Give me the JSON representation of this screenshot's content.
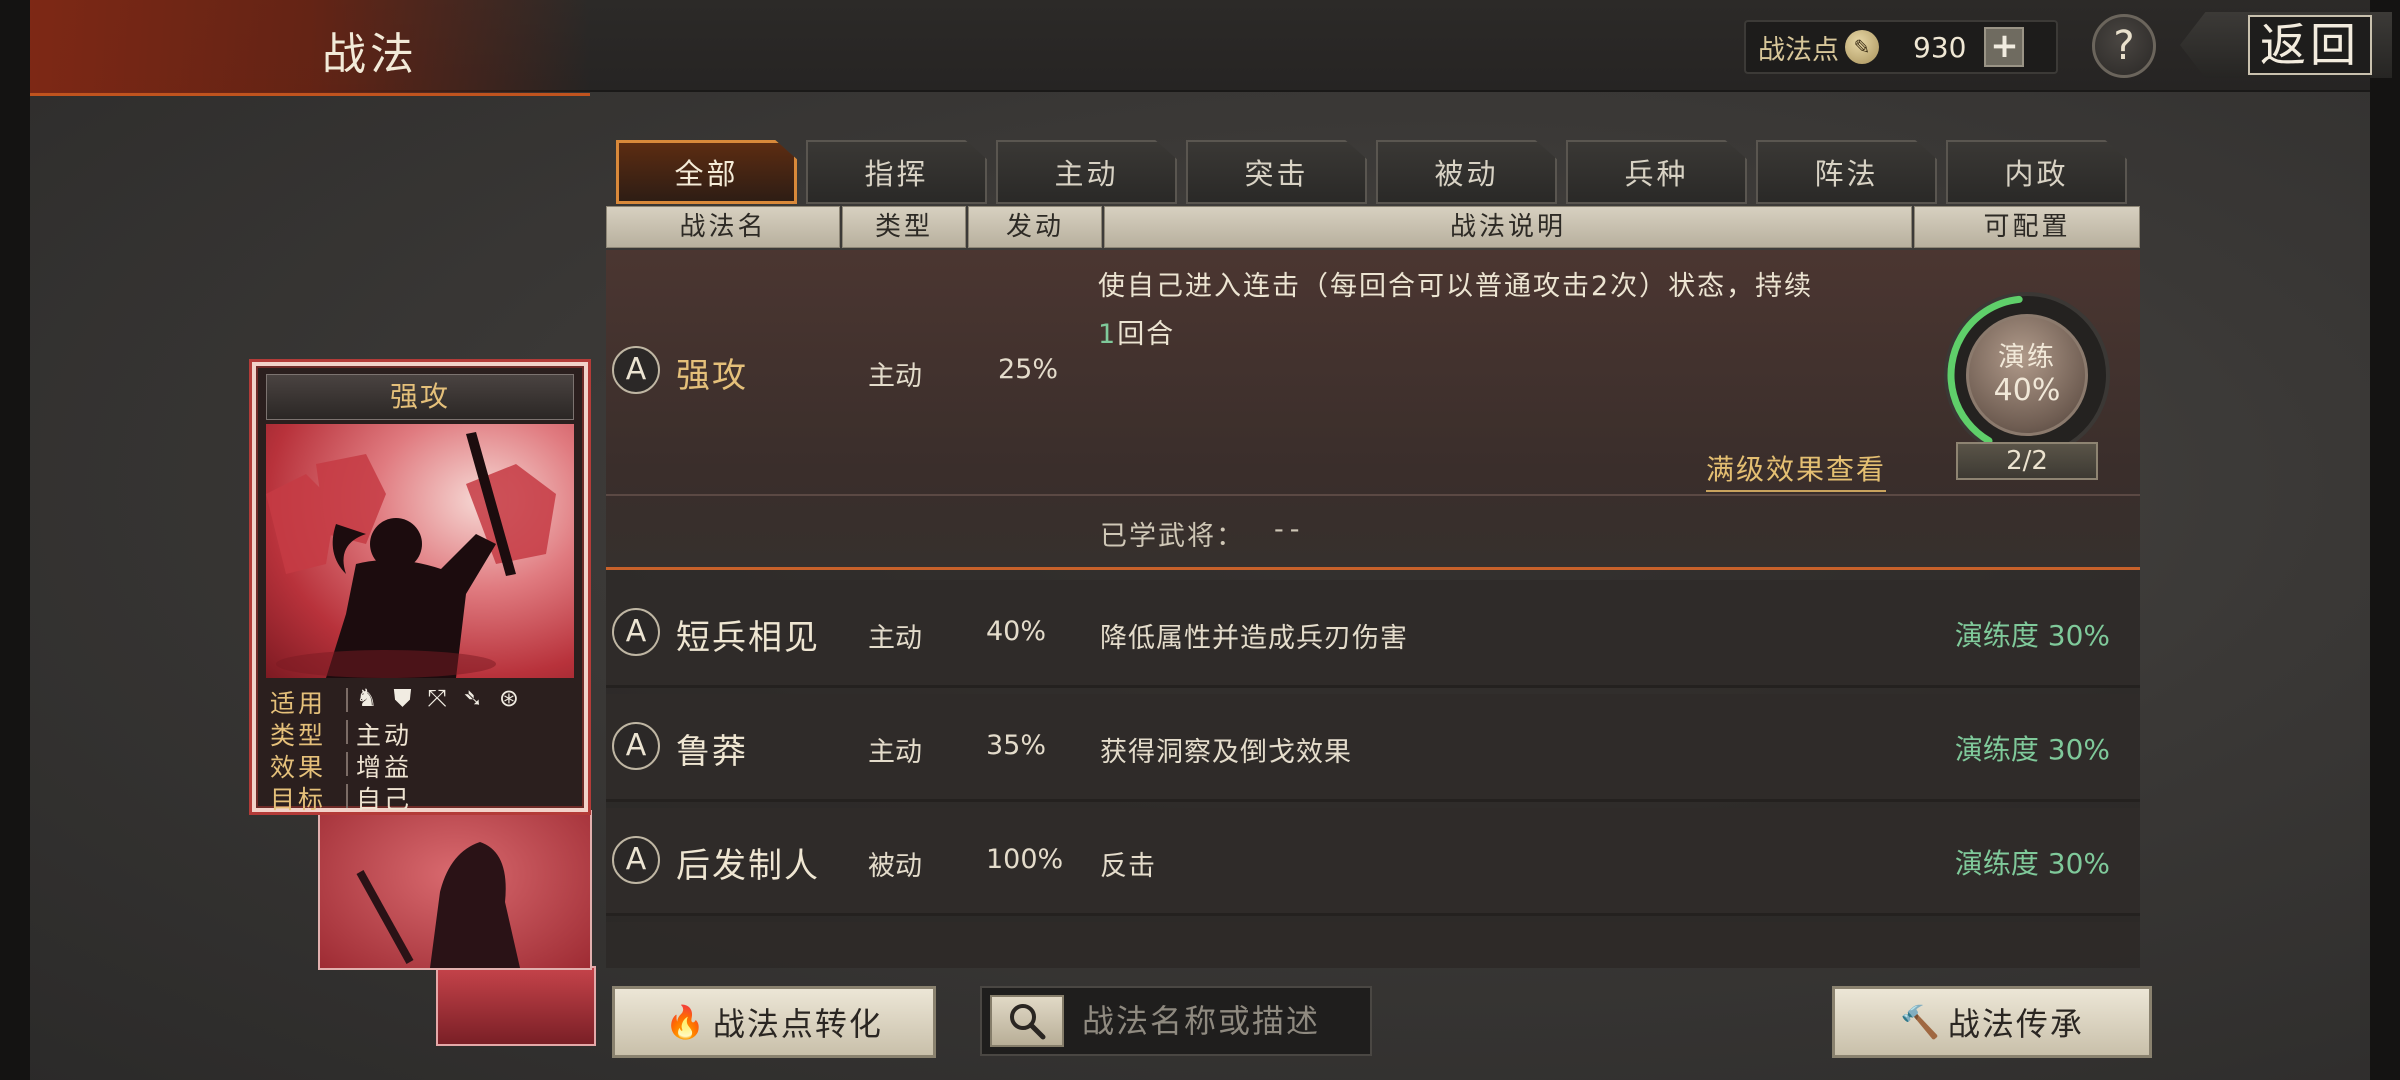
{
  "header": {
    "title": "战法",
    "points_label": "战法点",
    "points_value": "930",
    "plus_label": "+",
    "help_label": "?",
    "back_label": "返回"
  },
  "tabs": [
    {
      "label": "全部",
      "active": true
    },
    {
      "label": "指挥"
    },
    {
      "label": "主动"
    },
    {
      "label": "突击"
    },
    {
      "label": "被动"
    },
    {
      "label": "兵种"
    },
    {
      "label": "阵法"
    },
    {
      "label": "内政"
    }
  ],
  "columns": [
    "战法名",
    "类型",
    "发动",
    "战法说明",
    "可配置"
  ],
  "expanded": {
    "grade": "A",
    "name": "强攻",
    "type": "主动",
    "rate": "25%",
    "desc_line1": "使自己进入连击（每回合可以普通攻击2次）状态，持续",
    "desc_line2_num": "1",
    "desc_line2_text": "回合",
    "max_effect_link": "满级效果查看",
    "learned_label": "已学武将：",
    "learned_value": "--",
    "practice_label": "演练",
    "practice_percent": "40%",
    "practice_progress": 0.4,
    "practice_count": "2/2"
  },
  "rows": [
    {
      "grade": "A",
      "name": "短兵相见",
      "type": "主动",
      "rate": "40%",
      "desc": "降低属性并造成兵刃伤害",
      "practice": "演练度 30%"
    },
    {
      "grade": "A",
      "name": "鲁莽",
      "type": "主动",
      "rate": "35%",
      "desc": "获得洞察及倒戈效果",
      "practice": "演练度 30%"
    },
    {
      "grade": "A",
      "name": "后发制人",
      "type": "被动",
      "rate": "100%",
      "desc": "反击",
      "practice": "演练度 30%"
    }
  ],
  "card": {
    "title": "强攻",
    "applicable_label": "适用",
    "type_label": "类型",
    "type_value": "主动",
    "effect_label": "效果",
    "effect_value": "增益",
    "target_label": "目标",
    "target_value": "自己",
    "troop_icons": [
      "cavalry-icon",
      "shield-icon",
      "bow-icon",
      "spear-icon",
      "wheel-icon"
    ]
  },
  "bottom": {
    "convert_label": "战法点转化",
    "search_placeholder": "战法名称或描述",
    "inherit_label": "战法传承"
  },
  "colors": {
    "accent": "#d9893a",
    "practice_green": "#7fc99a",
    "gold": "#e5c07a"
  }
}
